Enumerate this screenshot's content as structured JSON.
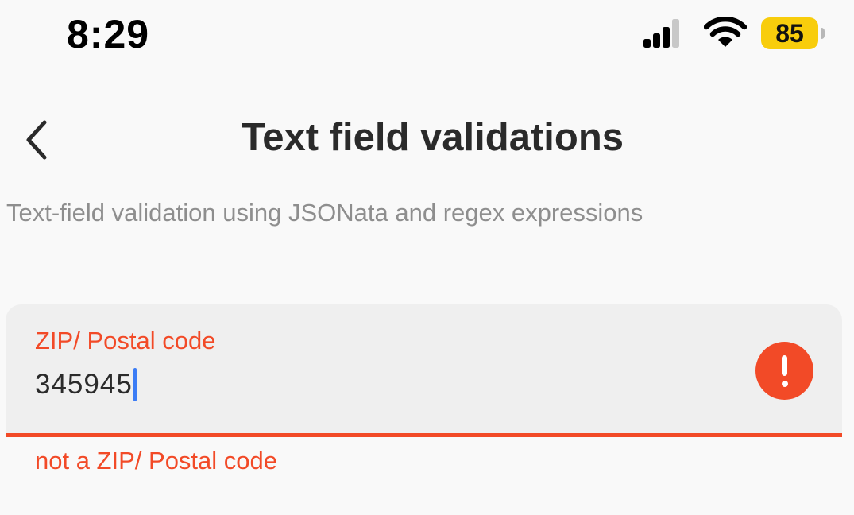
{
  "status_bar": {
    "time": "8:29",
    "battery_level": "85",
    "battery_color": "#f8cd0c",
    "icons": [
      "signal-icon",
      "wifi-icon",
      "battery-icon"
    ]
  },
  "header": {
    "back_icon": "chevron-left-icon",
    "title": "Text field validations"
  },
  "subtitle": "Text-field validation using JSONata and regex expressions",
  "field": {
    "label": "ZIP/ Postal code",
    "value": "345945",
    "error_icon": "exclamation-circle-icon",
    "error_message": "not a ZIP/ Postal code",
    "error_color": "#f24a27",
    "cursor_color": "#3b7cf5"
  }
}
